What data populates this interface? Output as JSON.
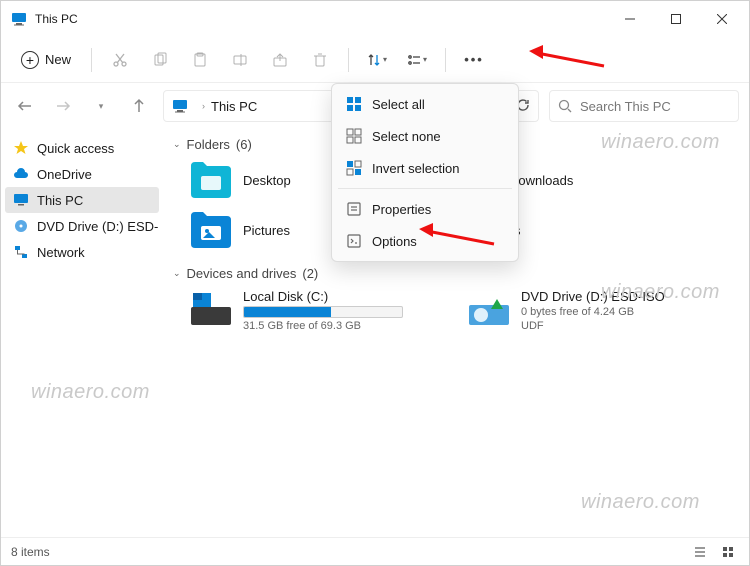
{
  "window": {
    "title": "This PC"
  },
  "toolbar": {
    "new_label": "New"
  },
  "breadcrumb": {
    "location": "This PC"
  },
  "search": {
    "placeholder": "Search This PC"
  },
  "sidebar": {
    "items": [
      {
        "label": "Quick access"
      },
      {
        "label": "OneDrive"
      },
      {
        "label": "This PC"
      },
      {
        "label": "DVD Drive (D:) ESD-ISO"
      },
      {
        "label": "Network"
      }
    ]
  },
  "sections": {
    "folders": {
      "label": "Folders",
      "count": "(6)"
    },
    "drives": {
      "label": "Devices and drives",
      "count": "(2)"
    }
  },
  "folders": [
    {
      "label": "Desktop"
    },
    {
      "label": "Downloads"
    },
    {
      "label": "Pictures"
    },
    {
      "label": "Videos"
    }
  ],
  "drives_list": [
    {
      "label": "Local Disk (C:)",
      "free": "31.5 GB free of 69.3 GB",
      "fill_pct": 55,
      "udf": ""
    },
    {
      "label": "DVD Drive (D:) ESD-ISO",
      "free": "0 bytes free of 4.24 GB",
      "fill_pct": 0,
      "udf": "UDF"
    }
  ],
  "popup": {
    "items": [
      {
        "label": "Select all"
      },
      {
        "label": "Select none"
      },
      {
        "label": "Invert selection"
      },
      {
        "label": "Properties"
      },
      {
        "label": "Options"
      }
    ]
  },
  "statusbar": {
    "count": "8 items"
  },
  "watermark": "winaero.com"
}
